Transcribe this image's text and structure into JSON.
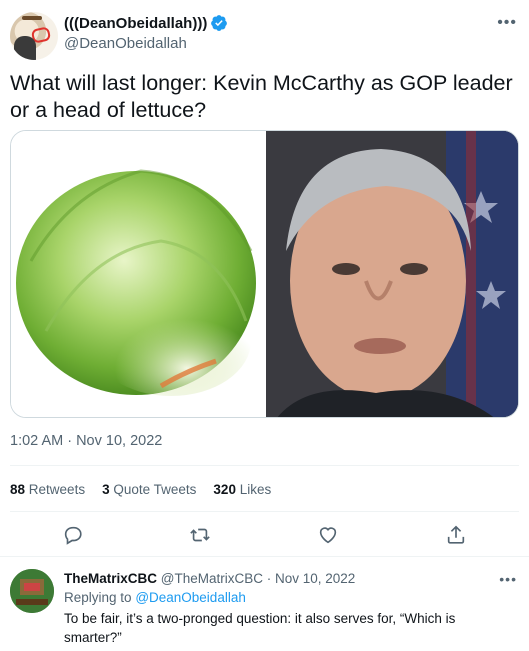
{
  "tweet": {
    "display_name": "(((DeanObeidallah)))",
    "handle": "@DeanObeidallah",
    "more_icon": "more-icon",
    "text": "What will last longer: Kevin McCarthy as GOP leader or a head of lettuce?",
    "timestamp": "1:02 AM · Nov 10, 2022",
    "stats": {
      "retweets_count": "88",
      "retweets_label": "Retweets",
      "quotes_count": "3",
      "quotes_label": "Quote Tweets",
      "likes_count": "320",
      "likes_label": "Likes"
    },
    "actions": [
      "reply-icon",
      "retweet-icon",
      "like-icon",
      "share-icon"
    ]
  },
  "reply": {
    "display_name": "TheMatrixCBC",
    "handle_date": "@TheMatrixCBC · Nov 10, 2022",
    "replying_prefix": "Replying to",
    "replying_to": "@DeanObeidallah",
    "text": "To be fair, it’s a two-pronged question: it also serves for, “Which is smarter?”"
  },
  "colors": {
    "accent": "#1d9bf0",
    "secondary_text": "#536471",
    "border": "#cfd9de"
  }
}
